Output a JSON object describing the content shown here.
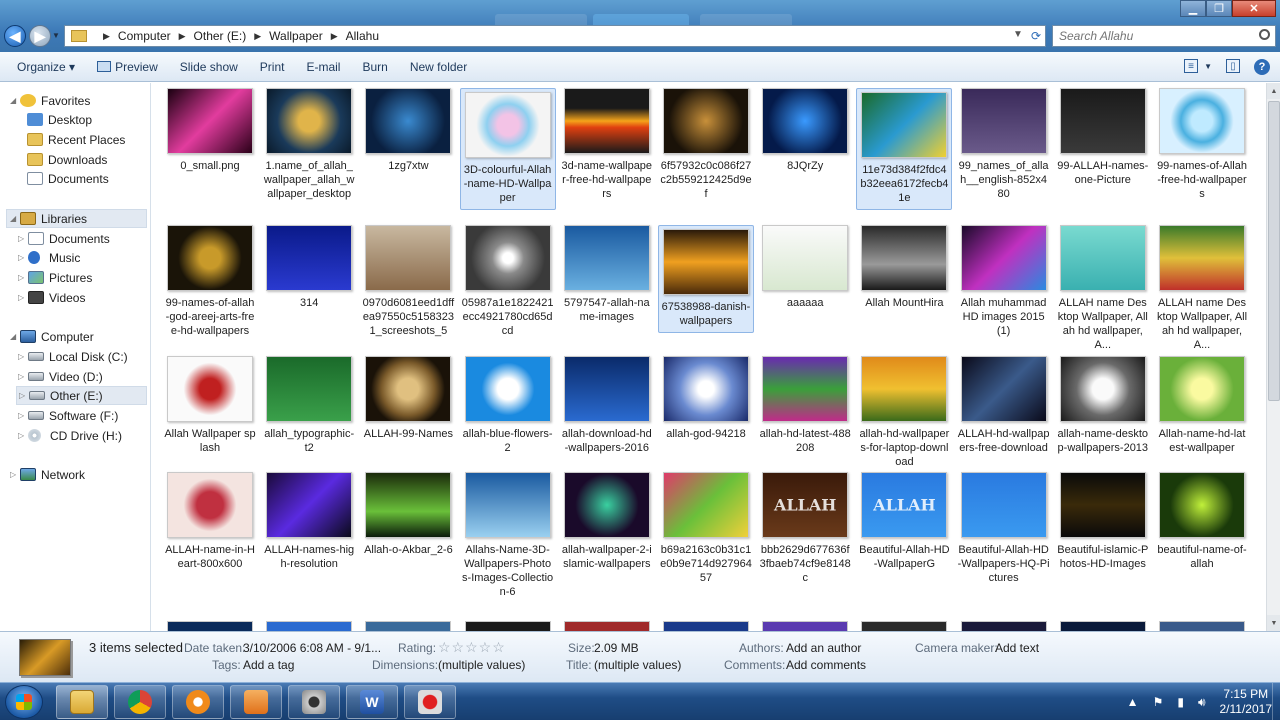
{
  "address": {
    "crumbs": [
      "Computer",
      "Other (E:)",
      "Wallpaper",
      "Allahu"
    ]
  },
  "search": {
    "placeholder": "Search Allahu"
  },
  "toolbar": {
    "organize": "Organize ▾",
    "preview": "Preview",
    "slideshow": "Slide show",
    "print": "Print",
    "email": "E-mail",
    "burn": "Burn",
    "new_folder": "New folder"
  },
  "nav": {
    "favorites": "Favorites",
    "desktop": "Desktop",
    "recent": "Recent Places",
    "downloads": "Downloads",
    "documents_fav": "Documents",
    "libraries": "Libraries",
    "documents": "Documents",
    "music": "Music",
    "pictures": "Pictures",
    "videos": "Videos",
    "computer": "Computer",
    "local_disk": "Local Disk (C:)",
    "video_d": "Video (D:)",
    "other_e": "Other (E:)",
    "software_f": "Software (F:)",
    "cd_h": "CD Drive (H:)",
    "network": "Network"
  },
  "files": [
    {
      "name": "0_small.png",
      "bg": "linear-gradient(135deg,#1a0010,#e23c9e 50%,#2a0018)",
      "sel": false
    },
    {
      "name": "1.name_of_allah_wallpaper_allah_wallpaper_desktop",
      "bg": "radial-gradient(circle,#e0b44a 20%,#1a3a5a 60%,#0a1a2a)",
      "sel": false
    },
    {
      "name": "1zg7xtw",
      "bg": "radial-gradient(circle,#3a8ad0,#0a2040 70%)",
      "sel": false
    },
    {
      "name": "3D-colourful-Allah-name-HD-Wallpaper",
      "bg": "radial-gradient(circle,#f3c3e6 20%,#8ed0f0 40%,#f4f4f4 60%)",
      "sel": true
    },
    {
      "name": "3d-name-wallpaper-free-hd-wallpapers",
      "bg": "linear-gradient(#1a1a1a 30%,#f5a41a 50%,#e04010 60%,#1a1a1a)",
      "sel": false
    },
    {
      "name": "6f57932c0c086f27c2b559212425d9ef",
      "bg": "radial-gradient(circle,#c8903a,#1a1208 70%)",
      "sel": false
    },
    {
      "name": "8JQrZy",
      "bg": "radial-gradient(circle,#3a9aff,#041a4a 70%)",
      "sel": false
    },
    {
      "name": "11e73d384f2fdc4b32eea6172fecb41e",
      "bg": "linear-gradient(135deg,#1a6a2a,#2a9ad0 50%,#f0d030)",
      "sel": true
    },
    {
      "name": "99_names_of_allah__english-852x480",
      "bg": "linear-gradient(#3a2a5a,#6a5a8a)",
      "sel": false
    },
    {
      "name": "99-ALLAH-names-one-Picture",
      "bg": "linear-gradient(#1a1a1a,#3a3a3a)",
      "sel": false
    },
    {
      "name": "99-names-of-Allah-free-hd-wallpapers",
      "bg": "radial-gradient(circle,#bfeaff 20%,#4ab0e0 40%,#d8f0ff 60%)",
      "sel": false
    },
    {
      "name": "99-names-of-allah-god-areej-arts-free-hd-wallpapers",
      "bg": "radial-gradient(circle,#c89a2a 20%,#1a1408 60%)",
      "sel": false
    },
    {
      "name": "314",
      "bg": "linear-gradient(#0a1a8a,#2a3ad0)",
      "sel": false
    },
    {
      "name": "0970d6081eed1dffea97550c51583231_screeshots_5",
      "bg": "linear-gradient(#c8b8a0,#8a6a4a)",
      "sel": false
    },
    {
      "name": "05987a1e1822421ecc4921780cd65dcd",
      "bg": "radial-gradient(circle,#fff 10%,#8a8a8a 30%,#3a3a3a 70%)",
      "sel": false
    },
    {
      "name": "5797547-allah-name-images",
      "bg": "linear-gradient(#1a5aa0,#6ab0e0)",
      "sel": false
    },
    {
      "name": "67538988-danish-wallpapers",
      "bg": "linear-gradient(#2a1a0a,#f0a020 50%,#4a2a0a)",
      "sel": true
    },
    {
      "name": "aaaaaa",
      "bg": "linear-gradient(#fafafa,#d8e8d0)",
      "sel": false
    },
    {
      "name": "Allah MountHira",
      "bg": "linear-gradient(#2a2a2a,#9a9a9a 60%,#1a1a1a)",
      "sel": false
    },
    {
      "name": "Allah muhammad HD images 2015 (1)",
      "bg": "linear-gradient(135deg,#1a0a2a,#c030c0 50%,#2a8ae0)",
      "sel": false
    },
    {
      "name": "ALLAH name Desktop Wallpaper, Allah hd wallpaper, A...",
      "bg": "linear-gradient(#7adad0,#3ab0b0)",
      "sel": false
    },
    {
      "name": "ALLAH name Desktop Wallpaper, Allah hd wallpaper, A...",
      "bg": "linear-gradient(#3a7a2a,#e0c03a 50%,#c0302a)",
      "sel": false
    },
    {
      "name": "Allah Wallpaper splash",
      "bg": "radial-gradient(circle,#c02020 20%,#fafafa 50%)",
      "sel": false
    },
    {
      "name": "allah_typographic-t2",
      "bg": "linear-gradient(#1a6a2a,#3aa04a)",
      "sel": false
    },
    {
      "name": "ALLAH-99-Names",
      "bg": "radial-gradient(circle,#e0c080 20%,#7a5a2a 50%,#1a1208 70%)",
      "sel": false
    },
    {
      "name": "allah-blue-flowers-2",
      "bg": "radial-gradient(circle,#fff 20%,#1a8ae0 50%)",
      "sel": false
    },
    {
      "name": "allah-download-hd-wallpapers-2016",
      "bg": "linear-gradient(#0a2a6a,#2a6ad0)",
      "sel": false
    },
    {
      "name": "allah-god-94218",
      "bg": "radial-gradient(circle,#fff 15%,#6a8ad0 50%,#1a2a6a)",
      "sel": false
    },
    {
      "name": "allah-hd-latest-488208",
      "bg": "linear-gradient(#6a2ab0,#3aa03a 50%,#c02a8a)",
      "sel": false
    },
    {
      "name": "allah-hd-wallpapers-for-laptop-download",
      "bg": "linear-gradient(#e08a1a,#f0c030 50%,#3a6a1a)",
      "sel": false
    },
    {
      "name": "ALLAH-hd-wallpapers-free-download",
      "bg": "linear-gradient(135deg,#0a0a1a,#3a5a8a 50%,#0a0a1a)",
      "sel": false
    },
    {
      "name": "allah-name-desktop-wallpapers-2013",
      "bg": "radial-gradient(circle,#fafafa 20%,#6a6a6a 50%,#1a1a1a)",
      "sel": false
    },
    {
      "name": "Allah-name-hd-latest-wallpaper",
      "bg": "radial-gradient(circle,#fafaa0 20%,#6ab03a 60%)",
      "sel": false
    },
    {
      "name": "ALLAH-name-in-Heart-800x600",
      "bg": "radial-gradient(circle,#c03040 25%,#f4e4e0 50%)",
      "sel": false
    },
    {
      "name": "ALLAH-names-high-resolution",
      "bg": "linear-gradient(135deg,#1a0a3a,#5a2ae0 50%,#0a0a1a)",
      "sel": false
    },
    {
      "name": "Allah-o-Akbar_2-6",
      "bg": "linear-gradient(#1a2a0a,#6ac03a 60%,#0a1a0a)",
      "sel": false
    },
    {
      "name": "Allahs-Name-3D-Wallpapers-Photos-Images-Collection-6",
      "bg": "linear-gradient(#1a5aa0,#9ad0f0)",
      "sel": false
    },
    {
      "name": "allah-wallpaper-2-islamic-wallpapers",
      "bg": "radial-gradient(circle,#3ad0a0,#1a0a2a 60%)",
      "sel": false
    },
    {
      "name": "b69a2163c0b31c1e0b9e714d92796457",
      "bg": "linear-gradient(135deg,#e03a6a,#6ac03a 50%,#f0d03a)",
      "sel": false
    },
    {
      "name": "bbb2629d677636f3fbaeb74cf9e8148c",
      "bg": "linear-gradient(#3a1a0a,#6a3a1a)",
      "sel": false
    },
    {
      "name": "Beautiful-Allah-HD-WallpaperG",
      "bg": "linear-gradient(#2a7ae0,#3a9af0)",
      "sel": false
    },
    {
      "name": "Beautiful-Allah-HD-Wallpapers-HQ-Pictures",
      "bg": "linear-gradient(#2a7ae0,#3a9af0)",
      "sel": false
    },
    {
      "name": "Beautiful-islamic-Photos-HD-Images",
      "bg": "linear-gradient(#0a0a0a,#3a2a0a 50%,#0a0a0a)",
      "sel": false
    },
    {
      "name": "beautiful-name-of-allah",
      "bg": "radial-gradient(circle,#c0f03a,#1a3a0a 60%)",
      "sel": false
    }
  ],
  "glyphs": {
    "allah_text": "ALLAH"
  },
  "details": {
    "selected": "3 items selected",
    "date_taken_label": "Date taken:",
    "date_taken_value": "3/10/2006 6:08 AM - 9/1...",
    "tags_label": "Tags:",
    "tags_value": "Add a tag",
    "rating_label": "Rating:",
    "rating_stars": "☆☆☆☆☆",
    "dimensions_label": "Dimensions:",
    "dimensions_value": "(multiple values)",
    "size_label": "Size:",
    "size_value": "2.09 MB",
    "title_label": "Title:",
    "title_value": "(multiple values)",
    "authors_label": "Authors:",
    "authors_value": "Add an author",
    "comments_label": "Comments:",
    "comments_value": "Add comments",
    "camera_label": "Camera maker:",
    "camera_value": "Add text"
  },
  "clock": {
    "time": "7:15 PM",
    "date": "2/11/2017"
  }
}
